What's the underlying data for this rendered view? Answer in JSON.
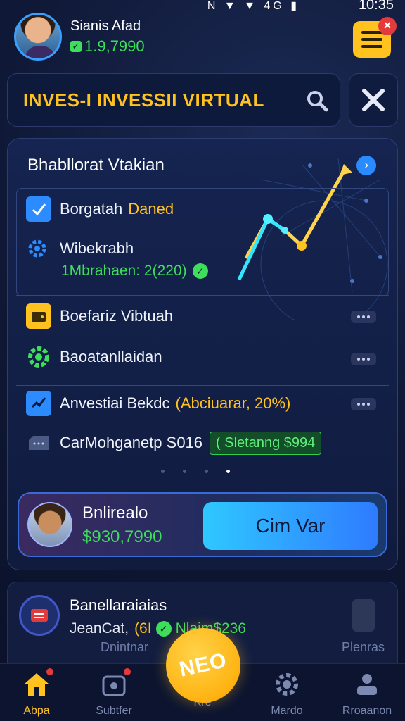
{
  "status_bar": {
    "icons": "N ▼ ▼ 4G ▮",
    "time": "10:35"
  },
  "profile": {
    "name": "Sianis Afad",
    "balance": "1.9,7990"
  },
  "header": {
    "title": "INVES-I INVESSII VIRTUAL"
  },
  "card": {
    "title": "Bhabllorat Vtakian",
    "row1": {
      "label_a": "Borgatah",
      "label_b": "Daned"
    },
    "row2": {
      "label": "Wibekrabh",
      "sub": "1Mbrahaen: 2(220)"
    },
    "row3": {
      "label": "Boefariz Vibtuah"
    },
    "row4": {
      "label": "Baoatanllaidan"
    },
    "row5": {
      "label_a": "Anvestiai Bekdc",
      "label_b": "(Abciuarar, 20%)"
    },
    "row6": {
      "label": "CarMohganetp S016",
      "badge": "( Sletanng $994"
    }
  },
  "cta": {
    "name": "Bnlirealo",
    "value": "$930,7990",
    "button": "Cim Var"
  },
  "bottom_card": {
    "title": "Banellaraiaias",
    "line_a": "JeanCat,",
    "line_b": "(6I",
    "line_c": "Nlaim$236",
    "sub_left": "Dnintnar",
    "sub_right": "Plenras"
  },
  "fab": {
    "label": "NEO"
  },
  "tabs": [
    {
      "label": "Abpa"
    },
    {
      "label": "Subtfer"
    },
    {
      "label": "Kre"
    },
    {
      "label": "Mardo"
    },
    {
      "label": "Rroaanon"
    }
  ],
  "colors": {
    "accent": "#ffc21f",
    "positive": "#3dde5a",
    "primary": "#2f7bff",
    "alert": "#e33b3b"
  }
}
